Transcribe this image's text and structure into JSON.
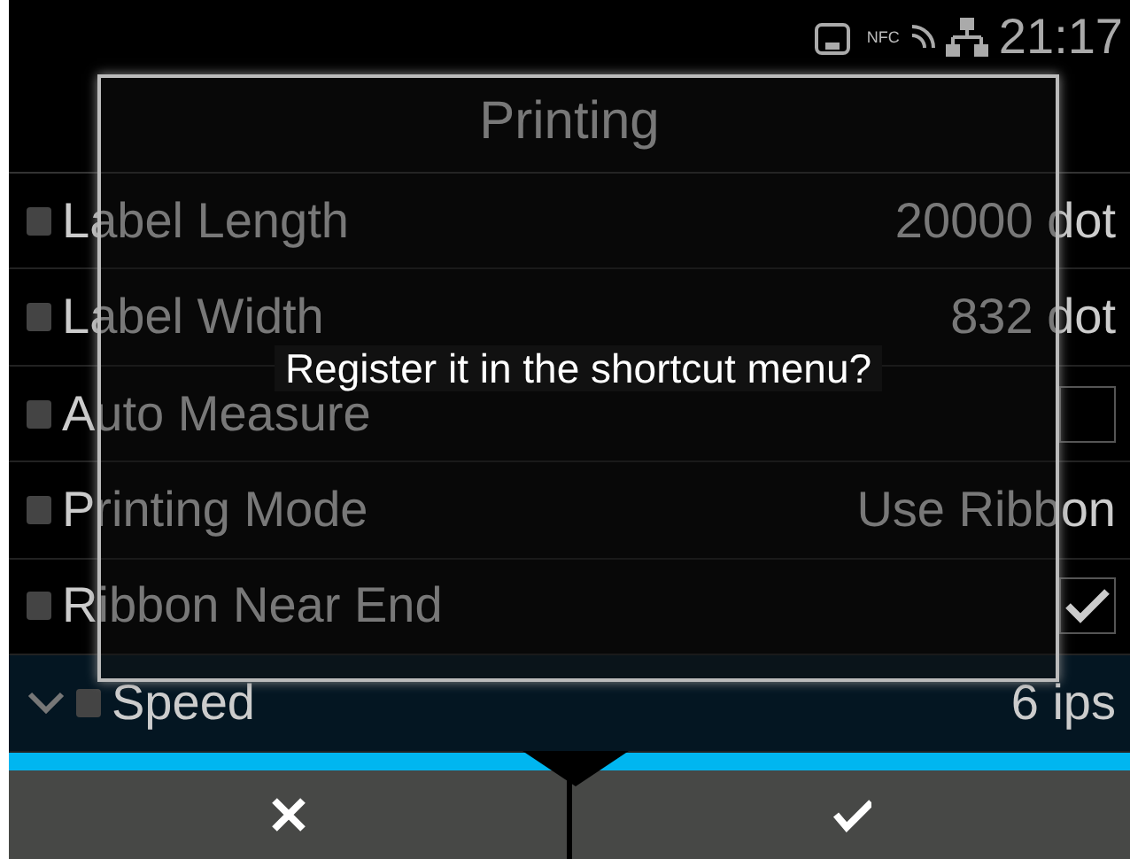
{
  "status_bar": {
    "nfc": "NFC",
    "time": "21:17"
  },
  "screen": {
    "title": "Printing"
  },
  "rows": [
    {
      "kind": "value",
      "label": "Label Length",
      "value": "20000 dot",
      "selected": false
    },
    {
      "kind": "value",
      "label": "Label Width",
      "value": "832 dot",
      "selected": false
    },
    {
      "kind": "checkbox",
      "label": "Auto Measure",
      "checked": false,
      "selected": false
    },
    {
      "kind": "value",
      "label": "Printing Mode",
      "value": "Use Ribbon",
      "selected": false
    },
    {
      "kind": "checkbox",
      "label": "Ribbon Near End",
      "checked": true,
      "selected": false
    },
    {
      "kind": "value",
      "label": "Speed",
      "value": "6 ips",
      "selected": true
    }
  ],
  "dialog": {
    "message": "Register it in the shortcut menu?"
  },
  "buttons": [
    {
      "kind": "cancel"
    },
    {
      "kind": "ok"
    }
  ]
}
